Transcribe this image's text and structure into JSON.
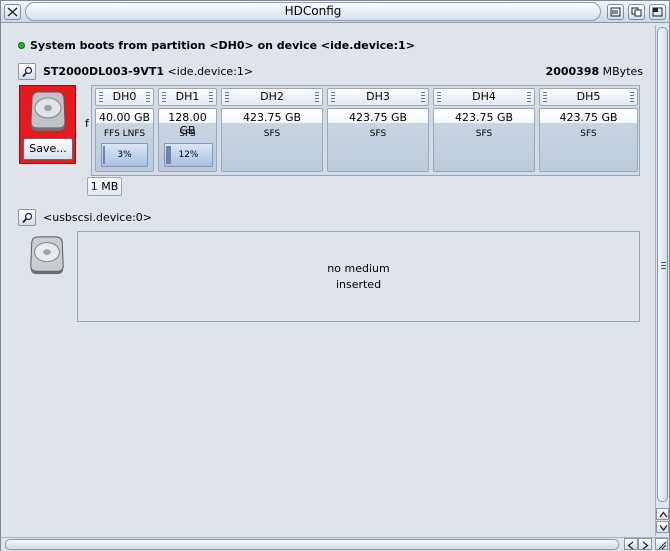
{
  "window": {
    "title": "HDConfig",
    "close_icon": "close-icon",
    "buttons": [
      "iconify-icon",
      "depth-icon",
      "zoom-icon"
    ]
  },
  "boot": {
    "text": "System boots from partition <DH0> on device <ide.device:1>",
    "led_color": "#1fb32a"
  },
  "device1": {
    "model": "ST2000DL003-9VT1",
    "device": "<ide.device:1>",
    "size_value": "2000398",
    "size_unit": "MBytes",
    "save_label": "Save...",
    "highlight_color": "#e8181c",
    "f_label": "f",
    "free_label": "1 MB",
    "partitions": [
      {
        "name": "DH0",
        "size": "40.00 GB",
        "fs": "FFS LNFS",
        "usage": "3%",
        "usage_fraction": 0.03
      },
      {
        "name": "DH1",
        "size": "128.00 GB",
        "fs": "SFS",
        "usage": "12%",
        "usage_fraction": 0.12
      },
      {
        "name": "DH2",
        "size": "423.75 GB",
        "fs": "SFS"
      },
      {
        "name": "DH3",
        "size": "423.75 GB",
        "fs": "SFS"
      },
      {
        "name": "DH4",
        "size": "423.75 GB",
        "fs": "SFS"
      },
      {
        "name": "DH5",
        "size": "423.75 GB",
        "fs": "SFS"
      }
    ]
  },
  "device2": {
    "device": "<usbscsi.device:0>",
    "medium_line1": "no medium",
    "medium_line2": "inserted"
  }
}
